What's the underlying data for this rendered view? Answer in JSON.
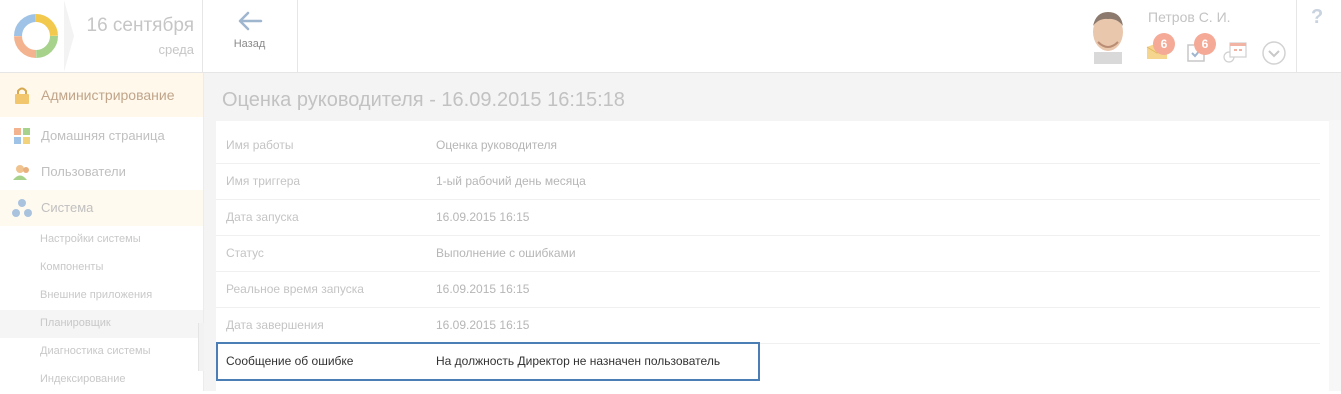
{
  "header": {
    "date": "16 сентября",
    "weekday": "среда",
    "back_label": "Назад",
    "user_name": "Петров С. И.",
    "mail_badge": "6",
    "tasks_badge": "6",
    "help_label": "?"
  },
  "sidebar": {
    "items": [
      {
        "label": "Администрирование",
        "icon": "lock-icon"
      },
      {
        "label": "Домашняя страница",
        "icon": "grid-icon"
      },
      {
        "label": "Пользователи",
        "icon": "users-icon"
      },
      {
        "label": "Система",
        "icon": "system-icon"
      }
    ],
    "sub_items": [
      {
        "label": "Настройки системы"
      },
      {
        "label": "Компоненты"
      },
      {
        "label": "Внешние приложения"
      },
      {
        "label": "Планировщик",
        "active": true
      },
      {
        "label": "Диагностика системы"
      },
      {
        "label": "Индексирование"
      }
    ]
  },
  "main": {
    "title": "Оценка руководителя - 16.09.2015 16:15:18",
    "rows": [
      {
        "label": "Имя работы",
        "value": "Оценка руководителя"
      },
      {
        "label": "Имя триггера",
        "value": "1-ый рабочий день месяца"
      },
      {
        "label": "Дата запуска",
        "value": "16.09.2015 16:15"
      },
      {
        "label": "Статус",
        "value": "Выполнение с ошибками"
      },
      {
        "label": "Реальное время запуска",
        "value": "16.09.2015 16:15"
      },
      {
        "label": "Дата завершения",
        "value": "16.09.2015 16:15"
      },
      {
        "label": "Сообщение об ошибке",
        "value": "На должность Директор не назначен пользователь"
      }
    ]
  },
  "colors": {
    "highlight_border": "#4a7eb5",
    "badge": "#f4aa97",
    "admin_bg": "#fff8eb"
  }
}
